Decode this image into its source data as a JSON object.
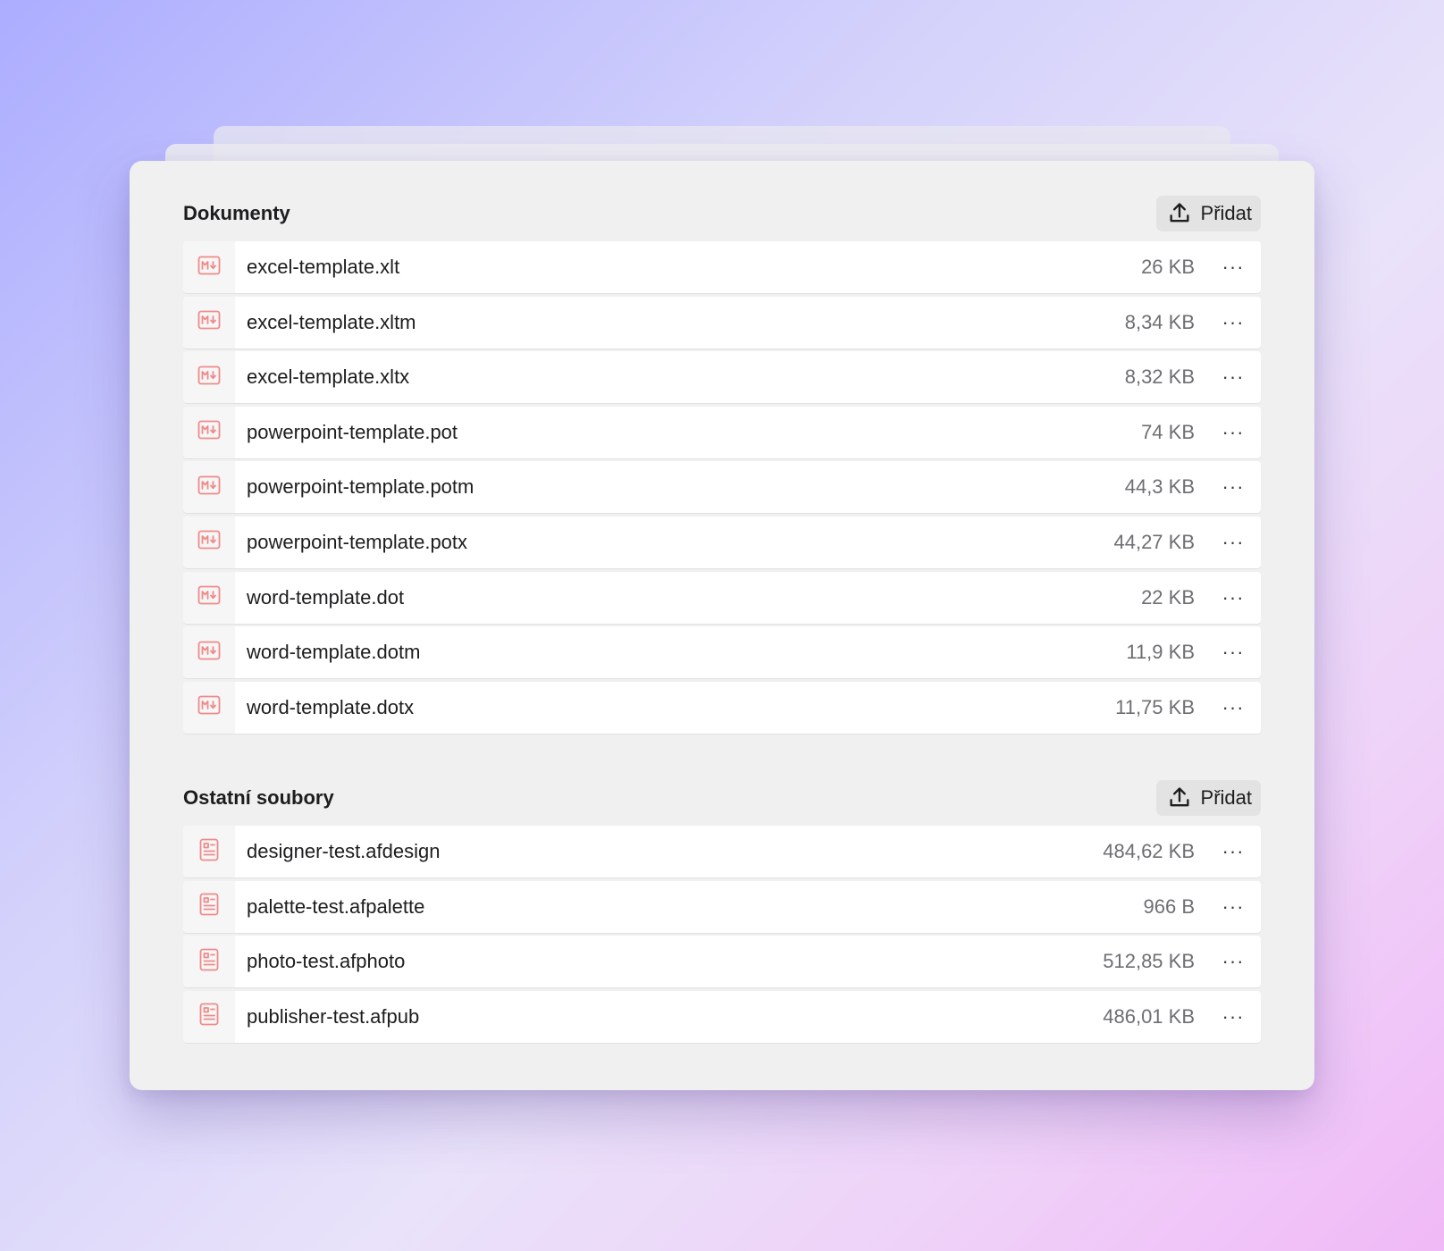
{
  "sections": [
    {
      "title": "Dokumenty",
      "add_label": "Přidat",
      "files": [
        {
          "name": "excel-template.xlt",
          "size": "26 KB",
          "icon": "markdown-file-icon"
        },
        {
          "name": "excel-template.xltm",
          "size": "8,34 KB",
          "icon": "markdown-file-icon"
        },
        {
          "name": "excel-template.xltx",
          "size": "8,32 KB",
          "icon": "markdown-file-icon"
        },
        {
          "name": "powerpoint-template.pot",
          "size": "74 KB",
          "icon": "markdown-file-icon"
        },
        {
          "name": "powerpoint-template.potm",
          "size": "44,3 KB",
          "icon": "markdown-file-icon"
        },
        {
          "name": "powerpoint-template.potx",
          "size": "44,27 KB",
          "icon": "markdown-file-icon"
        },
        {
          "name": "word-template.dot",
          "size": "22 KB",
          "icon": "markdown-file-icon"
        },
        {
          "name": "word-template.dotm",
          "size": "11,9 KB",
          "icon": "markdown-file-icon"
        },
        {
          "name": "word-template.dotx",
          "size": "11,75 KB",
          "icon": "markdown-file-icon"
        }
      ]
    },
    {
      "title": "Ostatní soubory",
      "add_label": "Přidat",
      "files": [
        {
          "name": "designer-test.afdesign",
          "size": "484,62 KB",
          "icon": "document-file-icon"
        },
        {
          "name": "palette-test.afpalette",
          "size": "966 B",
          "icon": "document-file-icon"
        },
        {
          "name": "photo-test.afphoto",
          "size": "512,85 KB",
          "icon": "document-file-icon"
        },
        {
          "name": "publisher-test.afpub",
          "size": "486,01 KB",
          "icon": "document-file-icon"
        }
      ]
    }
  ],
  "more_label": "···",
  "colors": {
    "icon_accent": "#ef8a8a",
    "card_background": "#f0f0f0",
    "row_background": "#ffffff",
    "text_primary": "#1d1d1f",
    "text_secondary": "#6e6e73"
  }
}
